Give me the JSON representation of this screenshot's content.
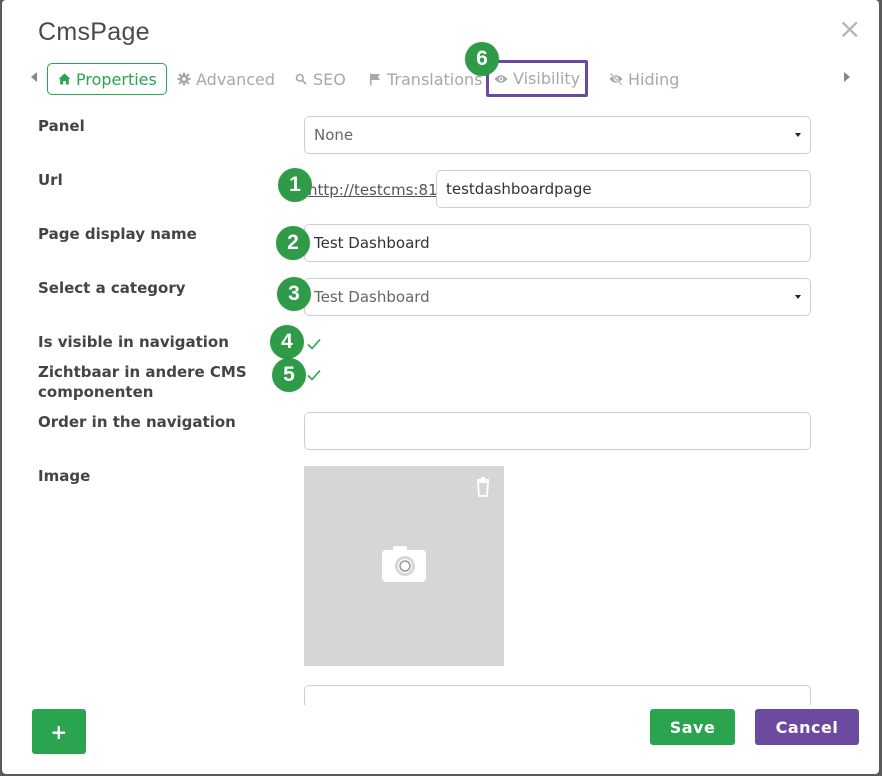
{
  "modal": {
    "title": "CmsPage",
    "close_glyph": "×"
  },
  "tabs": [
    {
      "label": "Properties",
      "icon": "home-icon",
      "active": true
    },
    {
      "label": "Advanced",
      "icon": "gear-icon"
    },
    {
      "label": "SEO",
      "icon": "search-icon"
    },
    {
      "label": "Translations",
      "icon": "flag-icon"
    },
    {
      "label": "Visibility",
      "icon": "eye-icon",
      "highlighted": true
    },
    {
      "label": "Hiding",
      "icon": "eye-slash-icon"
    }
  ],
  "form": {
    "panel": {
      "label": "Panel",
      "value": "None"
    },
    "url": {
      "label": "Url",
      "prefix": "http://testcms:81/",
      "value": "testdashboardpage"
    },
    "display_name": {
      "label": "Page display name",
      "value": "Test Dashboard"
    },
    "category": {
      "label": "Select a category",
      "value": "Test Dashboard"
    },
    "visible_nav": {
      "label": "Is visible in navigation",
      "checked": true
    },
    "visible_cms": {
      "label": "Zichtbaar in andere CMS componenten",
      "checked": true
    },
    "order": {
      "label": "Order in the navigation",
      "value": ""
    },
    "image": {
      "label": "Image"
    }
  },
  "badges": [
    "1",
    "2",
    "3",
    "4",
    "5",
    "6"
  ],
  "footer": {
    "add_label": "+",
    "save_label": "Save",
    "cancel_label": "Cancel"
  },
  "colors": {
    "primary_green": "#2aa44f",
    "badge_green": "#2f9a48",
    "purple": "#6c4aa0",
    "image_placeholder": "#d6d6d6"
  }
}
